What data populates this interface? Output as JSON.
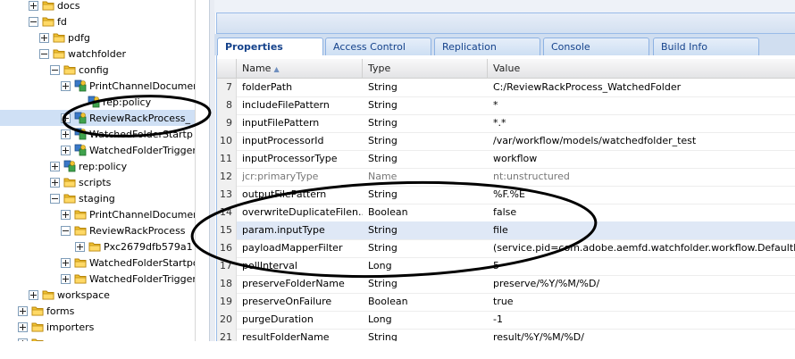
{
  "tree": [
    {
      "label": "docs",
      "icon": "folder",
      "toggle": "plus",
      "selected": false
    },
    {
      "label": "fd",
      "icon": "folder",
      "toggle": "minus",
      "selected": false
    },
    {
      "label": "pdfg",
      "icon": "folder",
      "toggle": "plus",
      "selected": false
    },
    {
      "label": "watchfolder",
      "icon": "folder",
      "toggle": "minus",
      "selected": false
    },
    {
      "label": "config",
      "icon": "folder",
      "toggle": "minus",
      "selected": false
    },
    {
      "label": "PrintChannelDocumen",
      "icon": "node",
      "toggle": "plus",
      "selected": false
    },
    {
      "label": "rep:policy",
      "icon": "node",
      "toggle": "none",
      "selected": false
    },
    {
      "label": "ReviewRackProcess_",
      "icon": "node",
      "toggle": "plus",
      "selected": true
    },
    {
      "label": "WatchedFolderStartp",
      "icon": "node",
      "toggle": "plus",
      "selected": false
    },
    {
      "label": "WatchedFolderTrigger",
      "icon": "node",
      "toggle": "plus",
      "selected": false
    },
    {
      "label": "rep:policy",
      "icon": "node",
      "toggle": "plus",
      "selected": false
    },
    {
      "label": "scripts",
      "icon": "folder",
      "toggle": "plus",
      "selected": false
    },
    {
      "label": "staging",
      "icon": "folder",
      "toggle": "minus",
      "selected": false
    },
    {
      "label": "PrintChannelDocumen",
      "icon": "folder",
      "toggle": "plus",
      "selected": false
    },
    {
      "label": "ReviewRackProcess",
      "icon": "folder",
      "toggle": "minus",
      "selected": false
    },
    {
      "label": "Pxc2679dfb579a1",
      "icon": "folder",
      "toggle": "plus",
      "selected": false
    },
    {
      "label": "WatchedFolderStartpo",
      "icon": "folder",
      "toggle": "plus",
      "selected": false
    },
    {
      "label": "WatchedFolderTrigger",
      "icon": "folder",
      "toggle": "plus",
      "selected": false
    },
    {
      "label": "workspace",
      "icon": "folder",
      "toggle": "plus",
      "selected": false
    },
    {
      "label": "forms",
      "icon": "folder",
      "toggle": "plus",
      "selected": false
    },
    {
      "label": "importers",
      "icon": "folder",
      "toggle": "plus",
      "selected": false
    },
    {
      "label": "",
      "icon": "folder",
      "toggle": "plus",
      "selected": false
    }
  ],
  "tabs": [
    {
      "label": "Properties",
      "active": true
    },
    {
      "label": "Access Control",
      "active": false
    },
    {
      "label": "Replication",
      "active": false
    },
    {
      "label": "Console",
      "active": false
    },
    {
      "label": "Build Info",
      "active": false
    }
  ],
  "grid": {
    "headers": {
      "name": "Name",
      "type": "Type",
      "value": "Value"
    },
    "rows": [
      {
        "n": "7",
        "name": "folderPath",
        "type": "String",
        "value": "C:/ReviewRackProcess_WatchedFolder",
        "selected": false,
        "dim": false
      },
      {
        "n": "8",
        "name": "includeFilePattern",
        "type": "String",
        "value": "*",
        "selected": false,
        "dim": false
      },
      {
        "n": "9",
        "name": "inputFilePattern",
        "type": "String",
        "value": "*.*",
        "selected": false,
        "dim": false
      },
      {
        "n": "10",
        "name": "inputProcessorId",
        "type": "String",
        "value": "/var/workflow/models/watchedfolder_test",
        "selected": false,
        "dim": false
      },
      {
        "n": "11",
        "name": "inputProcessorType",
        "type": "String",
        "value": "workflow",
        "selected": false,
        "dim": false
      },
      {
        "n": "12",
        "name": "jcr:primaryType",
        "type": "Name",
        "value": "nt:unstructured",
        "selected": false,
        "dim": true
      },
      {
        "n": "13",
        "name": "outputFilePattern",
        "type": "String",
        "value": "%F.%E",
        "selected": false,
        "dim": false
      },
      {
        "n": "14",
        "name": "overwriteDuplicateFilen...",
        "type": "Boolean",
        "value": "false",
        "selected": false,
        "dim": false
      },
      {
        "n": "15",
        "name": "param.inputType",
        "type": "String",
        "value": "file",
        "selected": true,
        "dim": false
      },
      {
        "n": "16",
        "name": "payloadMapperFilter",
        "type": "String",
        "value": "(service.pid=com.adobe.aemfd.watchfolder.workflow.DefaultPayloadMa",
        "selected": false,
        "dim": false
      },
      {
        "n": "17",
        "name": "pollInterval",
        "type": "Long",
        "value": "5",
        "selected": false,
        "dim": false
      },
      {
        "n": "18",
        "name": "preserveFolderName",
        "type": "String",
        "value": "preserve/%Y/%M/%D/",
        "selected": false,
        "dim": false
      },
      {
        "n": "19",
        "name": "preserveOnFailure",
        "type": "Boolean",
        "value": "true",
        "selected": false,
        "dim": false
      },
      {
        "n": "20",
        "name": "purgeDuration",
        "type": "Long",
        "value": "-1",
        "selected": false,
        "dim": false
      },
      {
        "n": "21",
        "name": "resultFolderName",
        "type": "String",
        "value": "result/%Y/%M/%D/",
        "selected": false,
        "dim": false
      }
    ]
  },
  "colors": {
    "accent": "#15428b",
    "tab_border": "#8db2e3",
    "selection": "#dfe8f6",
    "annotation": "#000000"
  }
}
